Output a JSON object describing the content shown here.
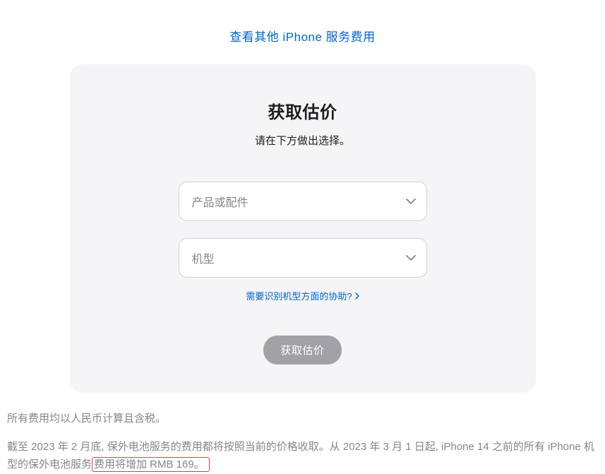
{
  "top_link": {
    "label": "查看其他 iPhone 服务费用"
  },
  "card": {
    "title": "获取估价",
    "subtitle": "请在下方做出选择。",
    "product_select": {
      "placeholder": "产品或配件"
    },
    "model_select": {
      "placeholder": "机型"
    },
    "help_link": "需要识别机型方面的协助?",
    "submit_label": "获取估价"
  },
  "footer": {
    "line1": "所有费用均以人民币计算且含税。",
    "line2_a": "截至 2023 年 2 月底, 保外电池服务的费用都将按照当前的价格收取。从 2023 年 3 月 1 日起, iPhone 14 之前的所有 iPhone 机型的保外电池服务",
    "line2_b": "费用将增加 RMB 169。"
  }
}
